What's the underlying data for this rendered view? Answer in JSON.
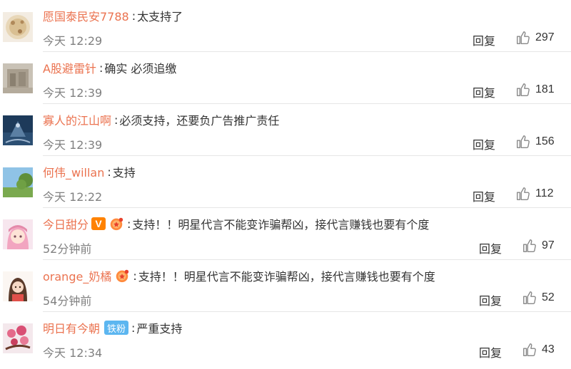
{
  "comments": [
    {
      "user": "愿国泰民安7788",
      "text": "太支持了",
      "time": "今天 12:29",
      "reply": "回复",
      "likes": "297"
    },
    {
      "user": "A股避雷针",
      "text": "确实 必须追缴",
      "time": "今天 12:39",
      "reply": "回复",
      "likes": "181"
    },
    {
      "user": "寡人的江山啊",
      "text": "必须支持，还要负广告推广责任",
      "time": "今天 12:39",
      "reply": "回复",
      "likes": "156"
    },
    {
      "user": "何伟_willan",
      "text": "支持",
      "time": "今天 12:22",
      "reply": "回复",
      "likes": "112"
    },
    {
      "user": "今日甜分",
      "badge_vip": "V",
      "text": "支持！！明星代言不能变诈骗帮凶，接代言赚钱也要有个度",
      "time": "52分钟前",
      "reply": "回复",
      "likes": "97"
    },
    {
      "user": "orange_奶橘",
      "text": "支持！！明星代言不能变诈骗帮凶，接代言赚钱也要有个度",
      "time": "54分钟前",
      "reply": "回复",
      "likes": "52"
    },
    {
      "user": "明日有今朝",
      "badge_fan": "铁粉",
      "text": "严重支持",
      "time": "今天 12:34",
      "reply": "回复",
      "likes": "43"
    }
  ],
  "colors": {
    "username": "#eb7350",
    "time": "#808080",
    "vip": "#ff8200",
    "fan_badge": "#5cb6f0"
  },
  "icons": {
    "like": "thumbs-up-icon",
    "fan": "fan-club-icon"
  }
}
